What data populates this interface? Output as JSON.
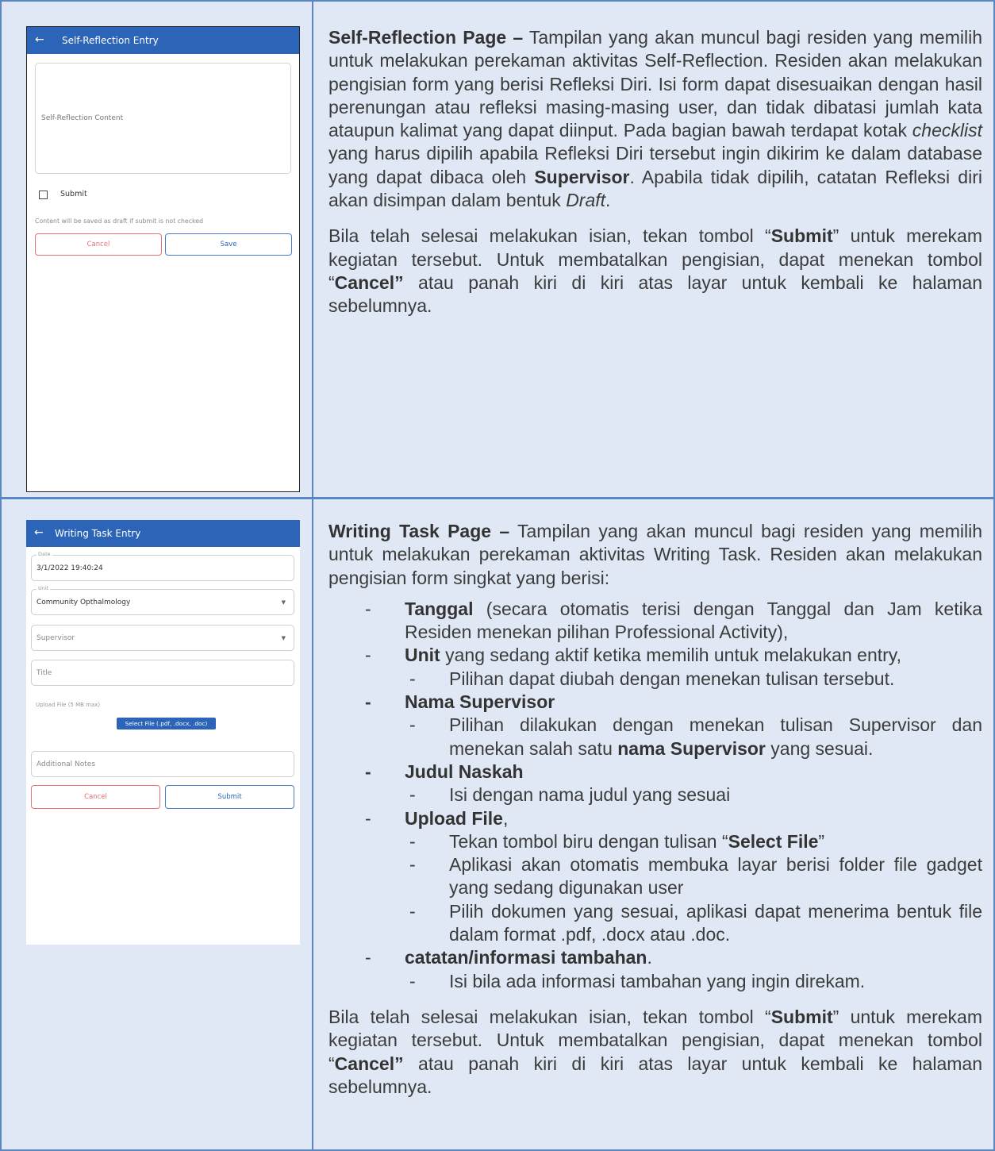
{
  "section1": {
    "phone": {
      "app_title": "Self-Reflection Entry",
      "back_glyph": "←",
      "content_placeholder": "Self-Reflection Content",
      "submit_checkbox_label": "Submit",
      "draft_hint": "Content will be saved as draft if submit is not checked",
      "cancel_label": "Cancel",
      "save_label": "Save"
    },
    "text": {
      "lead_bold": "Self-Reflection Page –",
      "p1_a": " Tampilan yang akan muncul bagi residen yang memilih untuk melakukan perekaman aktivitas Self-Reflection. Residen akan melakukan pengisian form yang berisi Refleksi Diri. Isi form dapat disesuaikan dengan hasil perenungan atau refleksi masing-masing user, dan tidak dibatasi jumlah kata ataupun kalimat yang dapat diinput. Pada bagian bawah terdapat kotak ",
      "p1_checklist": "checklist",
      "p1_b": " yang harus dipilih apabila Refleksi Diri tersebut ingin dikirim ke dalam database yang dapat dibaca oleh ",
      "p1_supervisor": "Supervisor",
      "p1_c": ". Apabila tidak dipilih, catatan Refleksi diri akan disimpan dalam bentuk ",
      "p1_draft": "Draft",
      "p1_end": ".",
      "p2_a": "Bila telah selesai melakukan isian, tekan tombol “",
      "p2_submit": "Submit",
      "p2_b": "” untuk merekam kegiatan tersebut. Untuk membatalkan pengisian, dapat menekan tombol “",
      "p2_cancel": "Cancel”",
      "p2_c": " atau panah kiri di kiri atas layar untuk kembali ke halaman sebelumnya."
    }
  },
  "section2": {
    "phone": {
      "app_title": "Writing Task Entry",
      "back_glyph": "←",
      "date_label": "Date",
      "date_value": "3/1/2022 19:40:24",
      "unit_label": "Unit",
      "unit_value": "Community Opthalmology",
      "supervisor_placeholder": "Supervisor",
      "title_placeholder": "Title",
      "upload_label": "Upload File (5 MB max)",
      "select_file_label": "Select File (.pdf, .docx, .doc)",
      "notes_placeholder": "Additional Notes",
      "cancel_label": "Cancel",
      "submit_label": "Submit",
      "dropdown_glyph": "▼"
    },
    "text": {
      "lead_bold": "Writing Task Page –",
      "intro": " Tampilan yang akan muncul bagi residen yang memilih untuk melakukan perekaman aktivitas Writing Task. Residen akan melakukan pengisian form singkat yang berisi:",
      "dash": "-",
      "items": [
        {
          "bold": "Tanggal",
          "text": " (secara otomatis terisi dengan Tanggal dan Jam ketika Residen menekan pilihan Professional Activity),"
        },
        {
          "bold": "Unit",
          "text": " yang sedang aktif ketika memilih untuk melakukan entry,"
        },
        {
          "text": "Pilihan dapat diubah dengan menekan tulisan tersebut."
        },
        {
          "bold": "Nama Supervisor"
        },
        {
          "text_a": "Pilihan dilakukan dengan menekan tulisan Supervisor dan menekan salah satu ",
          "bold": "nama Supervisor",
          "text_b": " yang sesuai."
        },
        {
          "bold": "Judul Naskah"
        },
        {
          "text": "Isi dengan nama judul yang sesuai"
        },
        {
          "bold": "Upload File",
          "text": ","
        },
        {
          "text_a": "Tekan tombol biru dengan tulisan “",
          "bold": "Select File",
          "text_b": "”"
        },
        {
          "text": "Aplikasi akan otomatis membuka layar berisi folder file gadget yang sedang digunakan user"
        },
        {
          "text": "Pilih dokumen yang sesuai, aplikasi dapat menerima bentuk file dalam format .pdf, .docx atau .doc."
        },
        {
          "bold": "catatan/informasi tambahan",
          "text": "."
        },
        {
          "text": "Isi bila ada informasi tambahan yang ingin direkam."
        }
      ],
      "p2_a": "Bila telah selesai melakukan isian, tekan tombol “",
      "p2_submit": "Submit",
      "p2_b": "” untuk merekam kegiatan tersebut. Untuk membatalkan pengisian, dapat menekan tombol “",
      "p2_cancel": "Cancel”",
      "p2_c": " atau panah kiri di kiri atas layar untuk kembali ke halaman sebelumnya."
    }
  }
}
